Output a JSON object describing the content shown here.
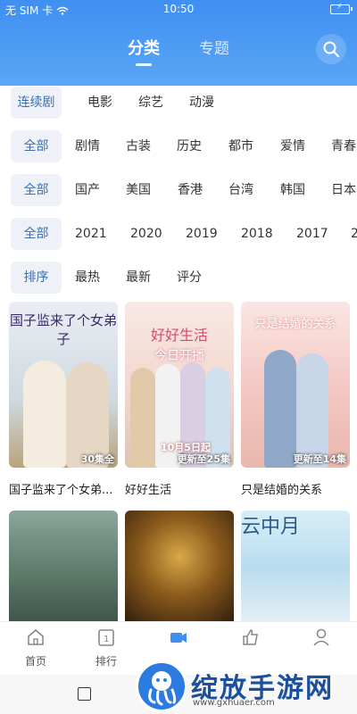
{
  "status_bar": {
    "carrier": "无 SIM 卡",
    "time": "10:50"
  },
  "header": {
    "tabs": [
      {
        "label": "分类",
        "active": true
      },
      {
        "label": "专题",
        "active": false
      }
    ],
    "search_icon": "search-icon",
    "accent_color": "#3f8ff2"
  },
  "filters": {
    "type": {
      "selected": "连续剧",
      "options": [
        "电影",
        "综艺",
        "动漫"
      ]
    },
    "genre": {
      "selected": "全部",
      "options": [
        "剧情",
        "古装",
        "历史",
        "都市",
        "爱情",
        "青春"
      ]
    },
    "region": {
      "selected": "全部",
      "options": [
        "国产",
        "美国",
        "香港",
        "台湾",
        "韩国",
        "日本"
      ]
    },
    "year": {
      "selected": "全部",
      "options": [
        "2021",
        "2020",
        "2019",
        "2018",
        "2017",
        "2"
      ]
    },
    "sort": {
      "selected": "排序",
      "options": [
        "最热",
        "最新",
        "评分"
      ]
    }
  },
  "shows": [
    {
      "title": "国子监来了个女弟...",
      "badge": "30集全",
      "poster_text": "国子监来了个女弟子"
    },
    {
      "title": "好好生活",
      "badge": "更新至25集",
      "poster_text": "好好生活",
      "subtext": "今日开播",
      "date": "10月5日起"
    },
    {
      "title": "只是结婚的关系",
      "badge": "更新至14集",
      "poster_text": "只是结婚的关系"
    }
  ],
  "shows_row2": [
    {
      "poster_text": ""
    },
    {
      "poster_text": ""
    },
    {
      "poster_text": "云中月"
    }
  ],
  "bottom_nav": [
    {
      "label": "首页",
      "icon": "home-icon"
    },
    {
      "label": "排行",
      "icon": "ranking-icon"
    },
    {
      "label": "",
      "icon": "video-icon",
      "active": true
    },
    {
      "label": "",
      "icon": "thumb-icon"
    },
    {
      "label": "",
      "icon": "user-icon"
    }
  ],
  "watermark": {
    "text": "绽放手游网",
    "url": "www.gxhuaer.com"
  }
}
